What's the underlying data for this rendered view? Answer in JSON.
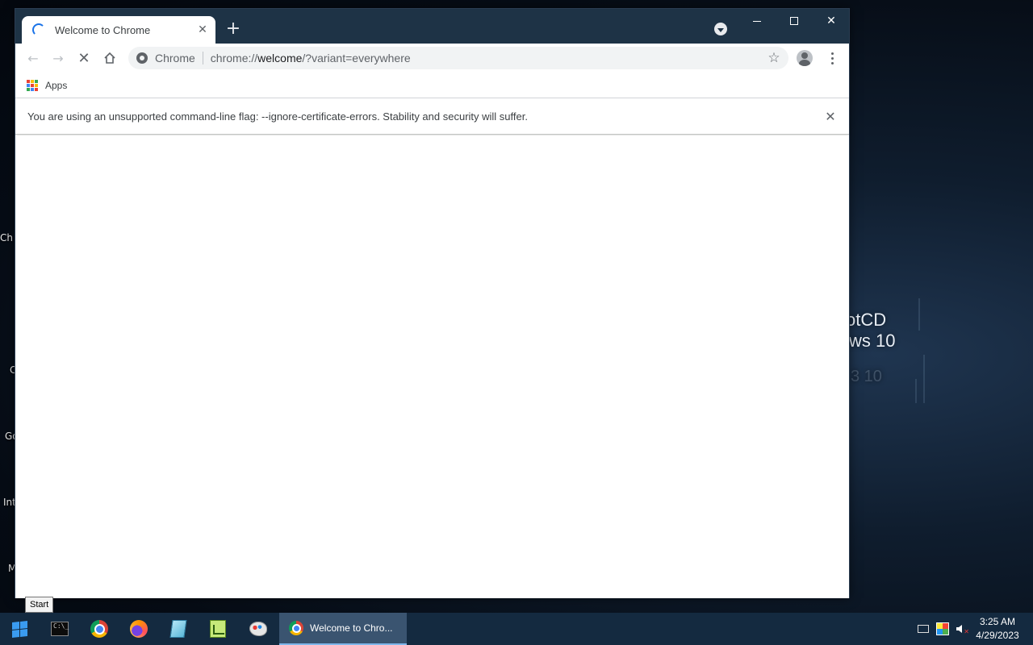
{
  "desktop": {
    "icon_labels": [
      "Ch",
      "C",
      "Go",
      "Int",
      "M"
    ],
    "wallpaper_line1": "otCD",
    "wallpaper_line2": "ws 10",
    "wallpaper_ghost": "3 10"
  },
  "browser": {
    "tab": {
      "title": "Welcome to Chrome"
    },
    "omnibox": {
      "chip": "Chrome",
      "url_prefix": "chrome://",
      "url_host": "welcome",
      "url_rest": "/?variant=everywhere"
    },
    "bookmarks": {
      "apps_label": "Apps"
    },
    "infobar": {
      "message": "You are using an unsupported command-line flag: --ignore-certificate-errors. Stability and security will suffer."
    },
    "accent_color": "#1a73e8",
    "titlebar_color": "#1e3346"
  },
  "tooltip": {
    "text": "Start"
  },
  "taskbar": {
    "active_window_label": "Welcome to Chro...",
    "clock_time": "3:25 AM",
    "clock_date": "4/29/2023",
    "pinned_icons": [
      "windows-start-icon",
      "cmd-icon",
      "chrome-icon",
      "firefox-icon",
      "notepad-icon",
      "chart-app-icon",
      "paint-icon"
    ]
  }
}
